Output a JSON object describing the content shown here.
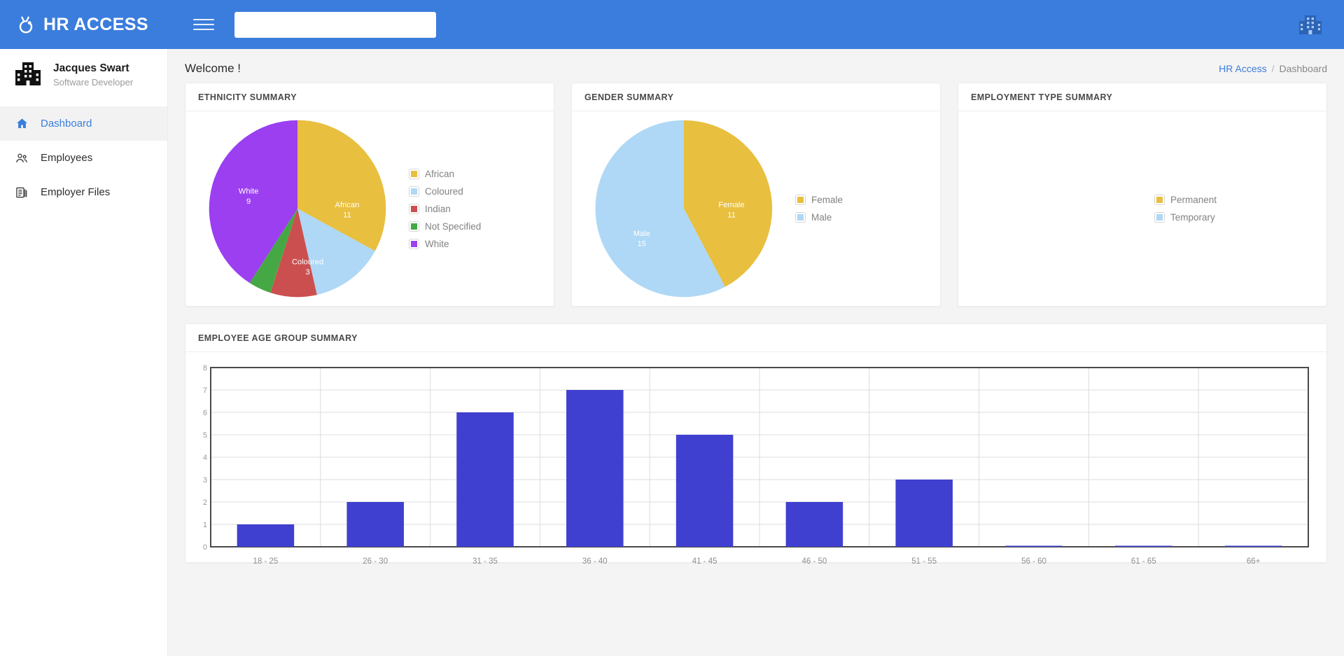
{
  "topbar": {
    "brand": "HR ACCESS",
    "brand_icon": "hr-access-logo-icon",
    "menu_icon": "hamburger-menu-icon",
    "search_value": "",
    "search_placeholder": "",
    "right_icon": "building-icon",
    "background": "#3b7ddd"
  },
  "sidebar": {
    "profile": {
      "avatar_icon": "building-avatar-icon",
      "name": "Jacques Swart",
      "role": "Software Developer"
    },
    "items": [
      {
        "label": "Dashboard",
        "icon": "home-icon",
        "active": true
      },
      {
        "label": "Employees",
        "icon": "people-icon",
        "active": false
      },
      {
        "label": "Employer Files",
        "icon": "documents-icon",
        "active": false
      }
    ]
  },
  "header": {
    "title": "Welcome !",
    "breadcrumb": {
      "root": "HR Access",
      "separator": "/",
      "current": "Dashboard"
    }
  },
  "cards": {
    "ethnicity_title": "ETHNICITY SUMMARY",
    "gender_title": "GENDER SUMMARY",
    "employment_title": "EMPLOYMENT TYPE SUMMARY",
    "age_title": "EMPLOYEE AGE GROUP SUMMARY"
  },
  "chart_data": [
    {
      "type": "pie",
      "title": "ETHNICITY SUMMARY",
      "legend_position": "right",
      "categories": [
        "African",
        "Coloured",
        "Indian",
        "Not Specified",
        "White"
      ],
      "values": [
        11,
        3,
        2,
        1,
        9
      ],
      "labels_shown": [
        "African\n11",
        "Coloured\n3",
        "",
        "",
        "White\n9"
      ],
      "colors": [
        "#e8bf3f",
        "#aed8f5",
        "#cc4f4f",
        "#46a845",
        "#9b3ff0"
      ]
    },
    {
      "type": "pie",
      "title": "GENDER SUMMARY",
      "legend_position": "right",
      "categories": [
        "Female",
        "Male"
      ],
      "values": [
        11,
        15
      ],
      "labels_shown": [
        "Female\n11",
        "Male\n15"
      ],
      "colors": [
        "#e8bf3f",
        "#aed8f5"
      ]
    },
    {
      "type": "pie",
      "title": "EMPLOYMENT TYPE SUMMARY",
      "legend_position": "right",
      "categories": [
        "Permanent",
        "Temporary"
      ],
      "values": [
        0,
        0
      ],
      "labels_shown": [],
      "colors": [
        "#e8bf3f",
        "#aed8f5"
      ]
    },
    {
      "type": "bar",
      "title": "EMPLOYEE AGE GROUP SUMMARY",
      "categories": [
        "18 - 25",
        "26 - 30",
        "31 - 35",
        "36 - 40",
        "41 - 45",
        "46 - 50",
        "51 - 55",
        "56 - 60",
        "61 - 65",
        "66+"
      ],
      "values": [
        1,
        2,
        6,
        7,
        5,
        2,
        3,
        0,
        0,
        0
      ],
      "ylim": [
        0,
        8
      ],
      "yticks": [
        0,
        1,
        2,
        3,
        4,
        5,
        6,
        7,
        8
      ],
      "xlabel": "",
      "ylabel": "",
      "grid": true,
      "bar_color": "#4040d0"
    }
  ]
}
